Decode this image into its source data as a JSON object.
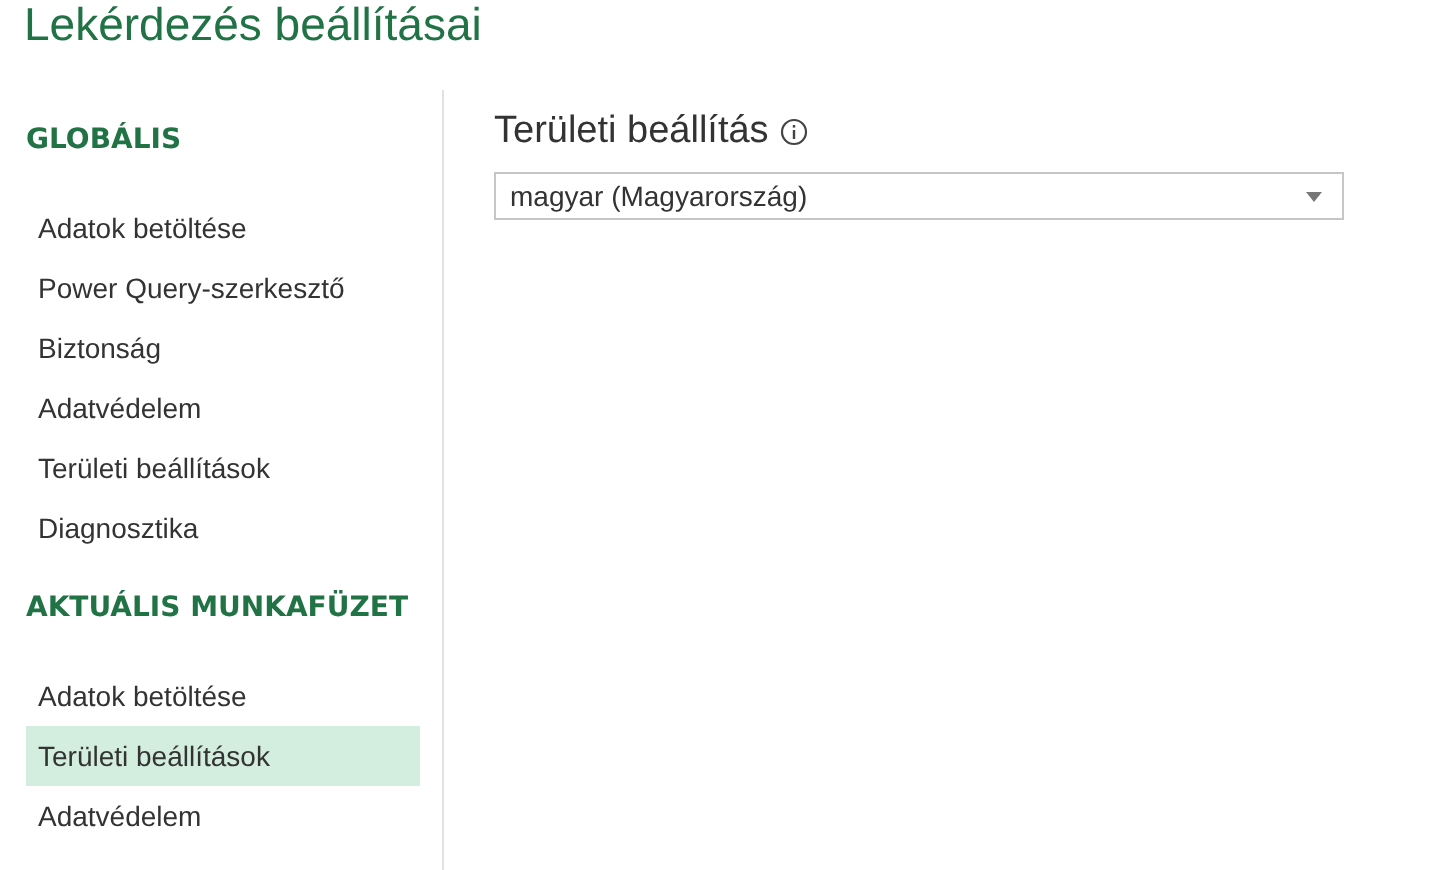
{
  "window": {
    "title": "Lekérdezés beállításai"
  },
  "sidebar": {
    "sections": [
      {
        "heading": "GLOBÁLIS",
        "items": [
          {
            "label": "Adatok betöltése",
            "selected": false
          },
          {
            "label": "Power Query-szerkesztő",
            "selected": false
          },
          {
            "label": "Biztonság",
            "selected": false
          },
          {
            "label": "Adatvédelem",
            "selected": false
          },
          {
            "label": "Területi beállítások",
            "selected": false
          },
          {
            "label": "Diagnosztika",
            "selected": false
          }
        ]
      },
      {
        "heading": "AKTUÁLIS MUNKAFÜZET",
        "items": [
          {
            "label": "Adatok betöltése",
            "selected": false
          },
          {
            "label": "Területi beállítások",
            "selected": true
          },
          {
            "label": "Adatvédelem",
            "selected": false
          }
        ]
      }
    ]
  },
  "content": {
    "heading": "Területi beállítás",
    "dropdown": {
      "value": "magyar (Magyarország)"
    }
  }
}
